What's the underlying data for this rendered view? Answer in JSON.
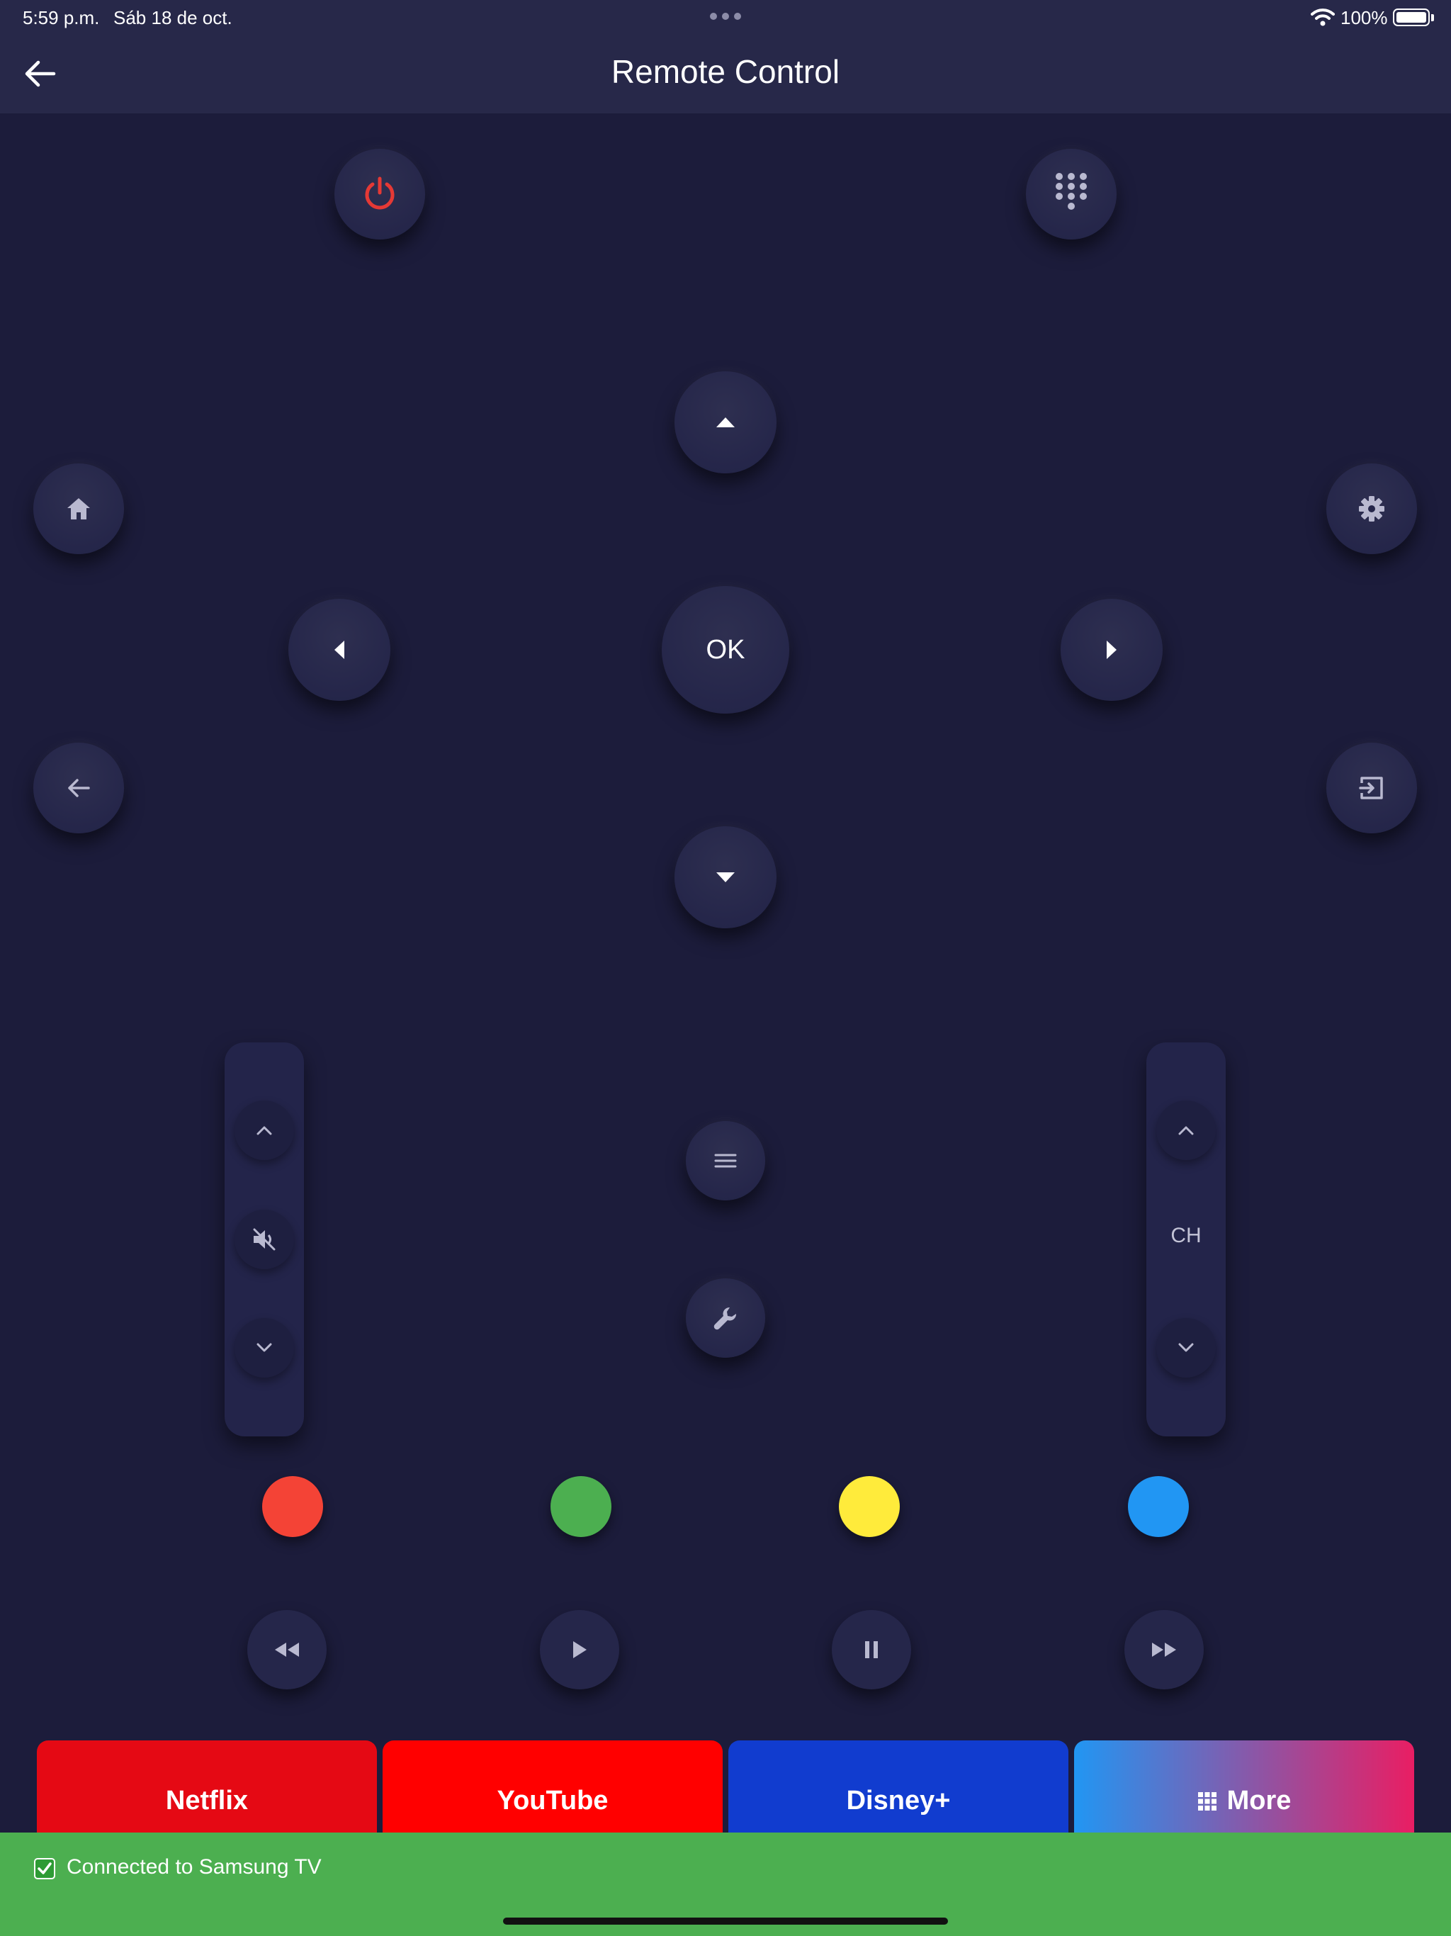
{
  "status_bar": {
    "time": "5:59 p.m.",
    "date": "Sáb 18 de oct.",
    "battery": "100%"
  },
  "app_bar": {
    "title": "Remote Control",
    "back_icon": "arrow-left-icon"
  },
  "top_buttons": {
    "power_icon": "power-icon",
    "keypad_icon": "dialpad-icon",
    "power_color": "#e53935"
  },
  "dpad": {
    "ok_label": "OK"
  },
  "side_buttons": {
    "home": "home-icon",
    "settings": "gear-icon",
    "back": "arrow-left-icon",
    "exit": "exit-icon"
  },
  "volume": {
    "up_icon": "chevron-up-icon",
    "mute_icon": "volume-mute-icon",
    "down_icon": "chevron-down-icon"
  },
  "channel": {
    "label": "CH",
    "up_icon": "chevron-up-icon",
    "down_icon": "chevron-down-icon"
  },
  "center_controls": {
    "menu_icon": "menu-icon",
    "tools_icon": "wrench-icon"
  },
  "color_keys": [
    "#f44336",
    "#4caf50",
    "#ffeb3b",
    "#2196f3"
  ],
  "media": [
    "rewind-icon",
    "play-icon",
    "pause-icon",
    "fast-forward-icon"
  ],
  "apps": [
    {
      "label": "Netflix",
      "color": "#e50914"
    },
    {
      "label": "YouTube",
      "color": "#ff0000"
    },
    {
      "label": "Disney+",
      "color": "#113ccf"
    },
    {
      "label": "More",
      "icon": "apps-grid-icon",
      "gradient": [
        "#2196f3",
        "#e91e63"
      ]
    }
  ],
  "toast": {
    "text": "Connected to Samsung TV",
    "color": "#4caf50"
  }
}
